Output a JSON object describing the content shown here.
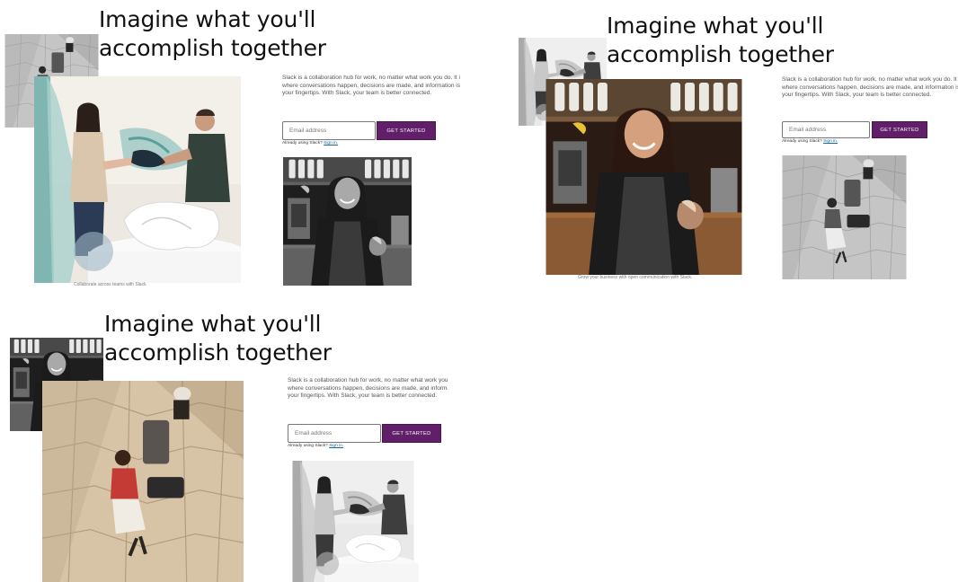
{
  "frames": [
    {
      "headline_line1": "Imagine what you'll",
      "headline_line2": "accomplish together",
      "desc_line1": "Slack is a collaboration hub for work, no matter what work you do. It is a",
      "desc_line2": "where conversations happen, decisions are made, and information is al",
      "desc_line3": "your fingertips. With Slack, your team is better connected.",
      "email_placeholder": "Email address",
      "cta_label": "GET STARTED",
      "signin_prefix": "Already using Slack?",
      "signin_link": "Sign in.",
      "caption": "Collaborate across teams with Slack"
    },
    {
      "headline_line1": "Imagine what you'll",
      "headline_line2": "accomplish together",
      "desc_line1": "Slack is a collaboration hub for work, no matter what work you do. It is a",
      "desc_line2": "where conversations happen, decisions are made, and information is alwa",
      "desc_line3": "your fingertips. With Slack, your team is better connected.",
      "email_placeholder": "Email address",
      "cta_label": "GET STARTED",
      "signin_prefix": "Already using Slack?",
      "signin_link": "Sign in.",
      "caption": "Grow your business with open communication with Slack."
    },
    {
      "headline_line1": "Imagine what you'll",
      "headline_line2": "accomplish together",
      "desc_line1": "Slack is a collaboration hub for work, no matter what work you",
      "desc_line2": "where conversations happen, decisions are made, and informa",
      "desc_line3": "your fingertips. With Slack, your team is better connected.",
      "email_placeholder": "Email address",
      "cta_label": "GET STARTED",
      "signin_prefix": "Already using Slack?",
      "signin_link": "Sign in."
    }
  ],
  "colors": {
    "cta_purple": "#611f69",
    "link_blue": "#1264a3",
    "text_dark": "#111111"
  },
  "images": {
    "office_team": "two-coworkers-holding-fabric",
    "barista": "smiling-barista-with-pastry",
    "aerial": "aerial-people-with-luggage"
  }
}
